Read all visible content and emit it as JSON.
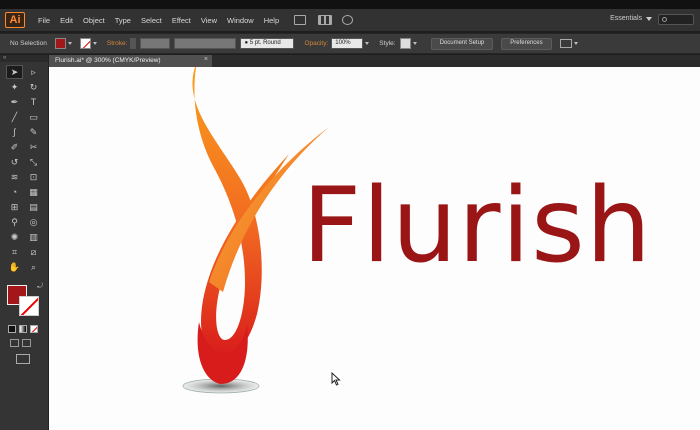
{
  "app": {
    "logo": "Ai",
    "menu": [
      "File",
      "Edit",
      "Object",
      "Type",
      "Select",
      "Effect",
      "View",
      "Window",
      "Help"
    ],
    "workspace": "Essentials"
  },
  "control_bar": {
    "selection": "No Selection",
    "stroke_label": "Stroke:",
    "brush": "5 pt. Round",
    "opacity_label": "Opacity:",
    "opacity_value": "100%",
    "style_label": "Style:",
    "document_setup": "Document Setup",
    "preferences": "Preferences",
    "fill_color": "#a01818",
    "stroke_color": "none"
  },
  "document": {
    "tab_title": "Flurish.ai* @ 300% (CMYK/Preview)",
    "close": "×"
  },
  "artwork": {
    "wordmark": "Flurish",
    "wordmark_color": "#9a1515",
    "flame_gradient": [
      "#f9a11d",
      "#f26a21",
      "#d81b1b"
    ]
  },
  "tools": {
    "icons": [
      "selection-tool",
      "direct-selection-tool",
      "magic-wand-tool",
      "lasso-tool",
      "pen-tool",
      "type-tool",
      "line-segment-tool",
      "rectangle-tool",
      "paintbrush-tool",
      "pencil-tool",
      "blob-brush-tool",
      "eraser-tool",
      "rotate-tool",
      "scale-tool",
      "warp-tool",
      "free-transform-tool",
      "shape-builder-tool",
      "perspective-grid-tool",
      "mesh-tool",
      "gradient-tool",
      "eyedropper-tool",
      "blend-tool",
      "symbol-sprayer-tool",
      "column-graph-tool",
      "artboard-tool",
      "slice-tool",
      "hand-tool",
      "zoom-tool"
    ]
  }
}
